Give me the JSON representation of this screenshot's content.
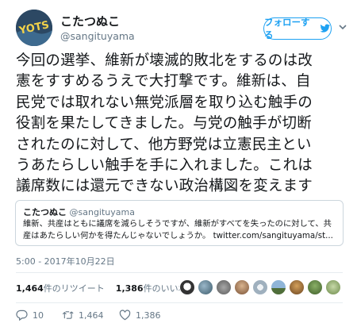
{
  "user": {
    "display_name": "こたつぬこ",
    "handle": "@sangituyama",
    "avatar_text": "YOTS"
  },
  "follow_button": {
    "label": "フォローする"
  },
  "tweet": {
    "lines": [
      "今回の選挙、維新が壊滅的敗北をするのは改",
      "憲をすすめるうえで大打撃です。維新は、自",
      "民党では取れない無党派層を取り込む触手の",
      "役割を果たしてきました。与党の触手が切断",
      "されたのに対して、他方野党は立憲民主とい",
      "うあたらしい触手を手に入れました。これは",
      "議席数には還元できない政治構図を変えます"
    ]
  },
  "quote": {
    "name": "こたつぬこ",
    "handle": "@sangituyama",
    "lines": [
      "維新、共産はともに議席を減らしそうですが、維新がすべてを失ったのに対して、共",
      "産はあたらしい何かを得たんじゃないでしょうか。 twitter.com/sangituyama/st..."
    ]
  },
  "timestamp": "5:00 - 2017年10月22日",
  "stats": {
    "retweets_num": "1,464",
    "retweets_label": "件のリツイート",
    "likes_num": "1,386",
    "likes_label": "件のいいね"
  },
  "actions": {
    "replies": "10",
    "retweets": "1,464",
    "likes": "1,386"
  },
  "colors": {
    "accent": "#1da1f2",
    "secondary_text": "#657786",
    "border": "#ccd6dd"
  }
}
